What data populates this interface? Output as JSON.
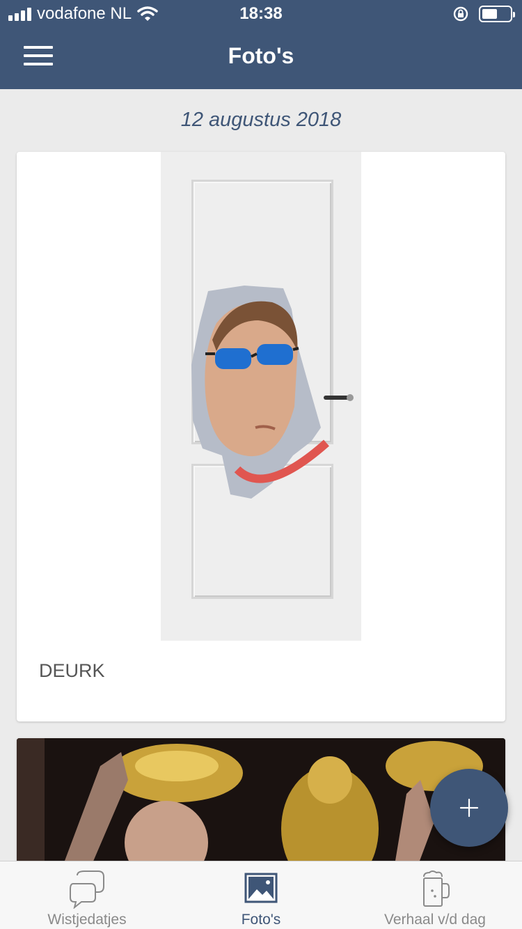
{
  "status_bar": {
    "carrier": "vodafone NL",
    "time": "18:38",
    "battery_level": 0.55
  },
  "header": {
    "title": "Foto's",
    "menu_icon": "hamburger-icon"
  },
  "feed": {
    "date": "12 augustus 2018",
    "posts": [
      {
        "caption": "DEURK",
        "image": "door-photo"
      },
      {
        "caption": "",
        "image": "golden-statues-photo"
      }
    ]
  },
  "fab": {
    "icon": "plus-icon"
  },
  "tab_bar": {
    "tabs": [
      {
        "label": "Wistjedatjes",
        "icon": "chat-bubbles-icon",
        "active": false
      },
      {
        "label": "Foto's",
        "icon": "picture-icon",
        "active": true
      },
      {
        "label": "Verhaal v/d dag",
        "icon": "beer-mug-icon",
        "active": false
      }
    ]
  },
  "colors": {
    "brand": "#3f5677",
    "background": "#ebebeb",
    "tab_inactive": "#8a8a8a"
  }
}
